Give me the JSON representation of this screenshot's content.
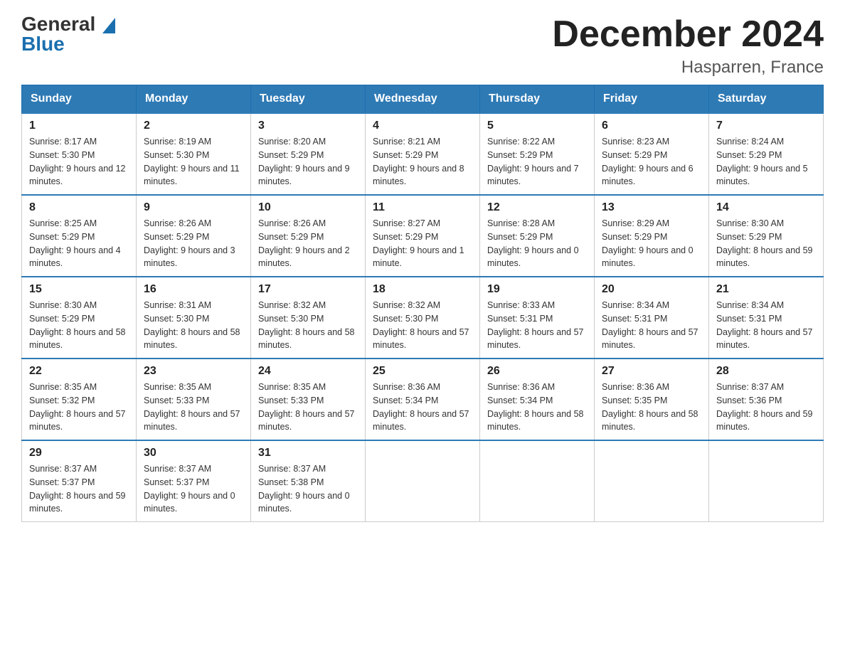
{
  "header": {
    "logo_line1": "General",
    "logo_line2": "Blue",
    "title": "December 2024",
    "subtitle": "Hasparren, France"
  },
  "weekdays": [
    "Sunday",
    "Monday",
    "Tuesday",
    "Wednesday",
    "Thursday",
    "Friday",
    "Saturday"
  ],
  "weeks": [
    [
      {
        "day": "1",
        "sunrise": "8:17 AM",
        "sunset": "5:30 PM",
        "daylight": "9 hours and 12 minutes."
      },
      {
        "day": "2",
        "sunrise": "8:19 AM",
        "sunset": "5:30 PM",
        "daylight": "9 hours and 11 minutes."
      },
      {
        "day": "3",
        "sunrise": "8:20 AM",
        "sunset": "5:29 PM",
        "daylight": "9 hours and 9 minutes."
      },
      {
        "day": "4",
        "sunrise": "8:21 AM",
        "sunset": "5:29 PM",
        "daylight": "9 hours and 8 minutes."
      },
      {
        "day": "5",
        "sunrise": "8:22 AM",
        "sunset": "5:29 PM",
        "daylight": "9 hours and 7 minutes."
      },
      {
        "day": "6",
        "sunrise": "8:23 AM",
        "sunset": "5:29 PM",
        "daylight": "9 hours and 6 minutes."
      },
      {
        "day": "7",
        "sunrise": "8:24 AM",
        "sunset": "5:29 PM",
        "daylight": "9 hours and 5 minutes."
      }
    ],
    [
      {
        "day": "8",
        "sunrise": "8:25 AM",
        "sunset": "5:29 PM",
        "daylight": "9 hours and 4 minutes."
      },
      {
        "day": "9",
        "sunrise": "8:26 AM",
        "sunset": "5:29 PM",
        "daylight": "9 hours and 3 minutes."
      },
      {
        "day": "10",
        "sunrise": "8:26 AM",
        "sunset": "5:29 PM",
        "daylight": "9 hours and 2 minutes."
      },
      {
        "day": "11",
        "sunrise": "8:27 AM",
        "sunset": "5:29 PM",
        "daylight": "9 hours and 1 minute."
      },
      {
        "day": "12",
        "sunrise": "8:28 AM",
        "sunset": "5:29 PM",
        "daylight": "9 hours and 0 minutes."
      },
      {
        "day": "13",
        "sunrise": "8:29 AM",
        "sunset": "5:29 PM",
        "daylight": "9 hours and 0 minutes."
      },
      {
        "day": "14",
        "sunrise": "8:30 AM",
        "sunset": "5:29 PM",
        "daylight": "8 hours and 59 minutes."
      }
    ],
    [
      {
        "day": "15",
        "sunrise": "8:30 AM",
        "sunset": "5:29 PM",
        "daylight": "8 hours and 58 minutes."
      },
      {
        "day": "16",
        "sunrise": "8:31 AM",
        "sunset": "5:30 PM",
        "daylight": "8 hours and 58 minutes."
      },
      {
        "day": "17",
        "sunrise": "8:32 AM",
        "sunset": "5:30 PM",
        "daylight": "8 hours and 58 minutes."
      },
      {
        "day": "18",
        "sunrise": "8:32 AM",
        "sunset": "5:30 PM",
        "daylight": "8 hours and 57 minutes."
      },
      {
        "day": "19",
        "sunrise": "8:33 AM",
        "sunset": "5:31 PM",
        "daylight": "8 hours and 57 minutes."
      },
      {
        "day": "20",
        "sunrise": "8:34 AM",
        "sunset": "5:31 PM",
        "daylight": "8 hours and 57 minutes."
      },
      {
        "day": "21",
        "sunrise": "8:34 AM",
        "sunset": "5:31 PM",
        "daylight": "8 hours and 57 minutes."
      }
    ],
    [
      {
        "day": "22",
        "sunrise": "8:35 AM",
        "sunset": "5:32 PM",
        "daylight": "8 hours and 57 minutes."
      },
      {
        "day": "23",
        "sunrise": "8:35 AM",
        "sunset": "5:33 PM",
        "daylight": "8 hours and 57 minutes."
      },
      {
        "day": "24",
        "sunrise": "8:35 AM",
        "sunset": "5:33 PM",
        "daylight": "8 hours and 57 minutes."
      },
      {
        "day": "25",
        "sunrise": "8:36 AM",
        "sunset": "5:34 PM",
        "daylight": "8 hours and 57 minutes."
      },
      {
        "day": "26",
        "sunrise": "8:36 AM",
        "sunset": "5:34 PM",
        "daylight": "8 hours and 58 minutes."
      },
      {
        "day": "27",
        "sunrise": "8:36 AM",
        "sunset": "5:35 PM",
        "daylight": "8 hours and 58 minutes."
      },
      {
        "day": "28",
        "sunrise": "8:37 AM",
        "sunset": "5:36 PM",
        "daylight": "8 hours and 59 minutes."
      }
    ],
    [
      {
        "day": "29",
        "sunrise": "8:37 AM",
        "sunset": "5:37 PM",
        "daylight": "8 hours and 59 minutes."
      },
      {
        "day": "30",
        "sunrise": "8:37 AM",
        "sunset": "5:37 PM",
        "daylight": "9 hours and 0 minutes."
      },
      {
        "day": "31",
        "sunrise": "8:37 AM",
        "sunset": "5:38 PM",
        "daylight": "9 hours and 0 minutes."
      },
      null,
      null,
      null,
      null
    ]
  ]
}
